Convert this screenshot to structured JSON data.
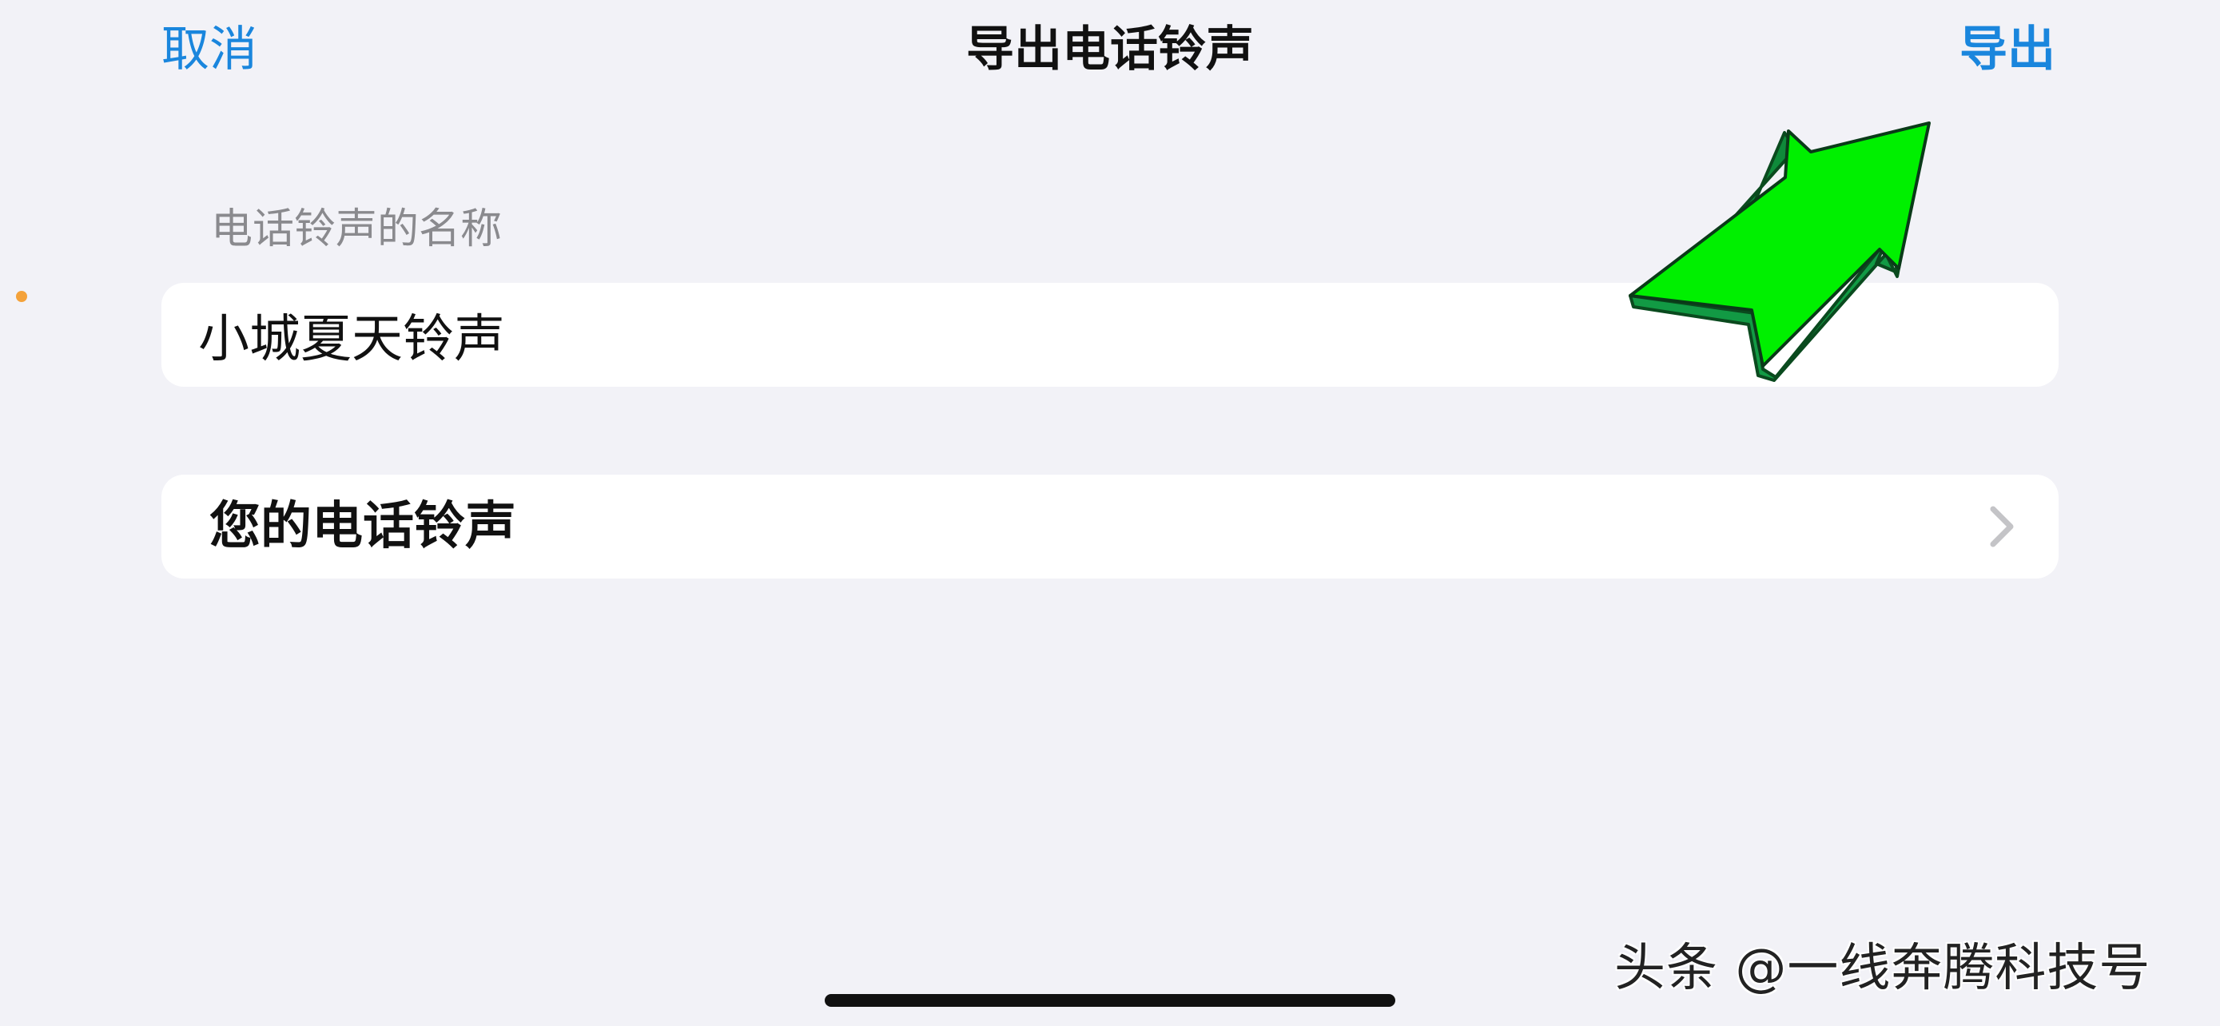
{
  "nav": {
    "cancel_label": "取消",
    "title": "导出电话铃声",
    "export_label": "导出"
  },
  "form": {
    "name_section_label": "电话铃声的名称",
    "name_value": "小城夏天铃声",
    "ringtones_row_label": "您的电话铃声"
  },
  "watermark": {
    "text": "头条 @一线奔腾科技号"
  },
  "icons": {
    "chevron": "chevron-right-icon",
    "arrow": "annotation-arrow-icon"
  },
  "colors": {
    "background": "#f2f2f7",
    "accent": "#1a86dd",
    "card": "#ffffff",
    "section_label": "#8a8a8e",
    "arrow_fill": "#00f000",
    "arrow_outline": "#0a6a2a"
  }
}
